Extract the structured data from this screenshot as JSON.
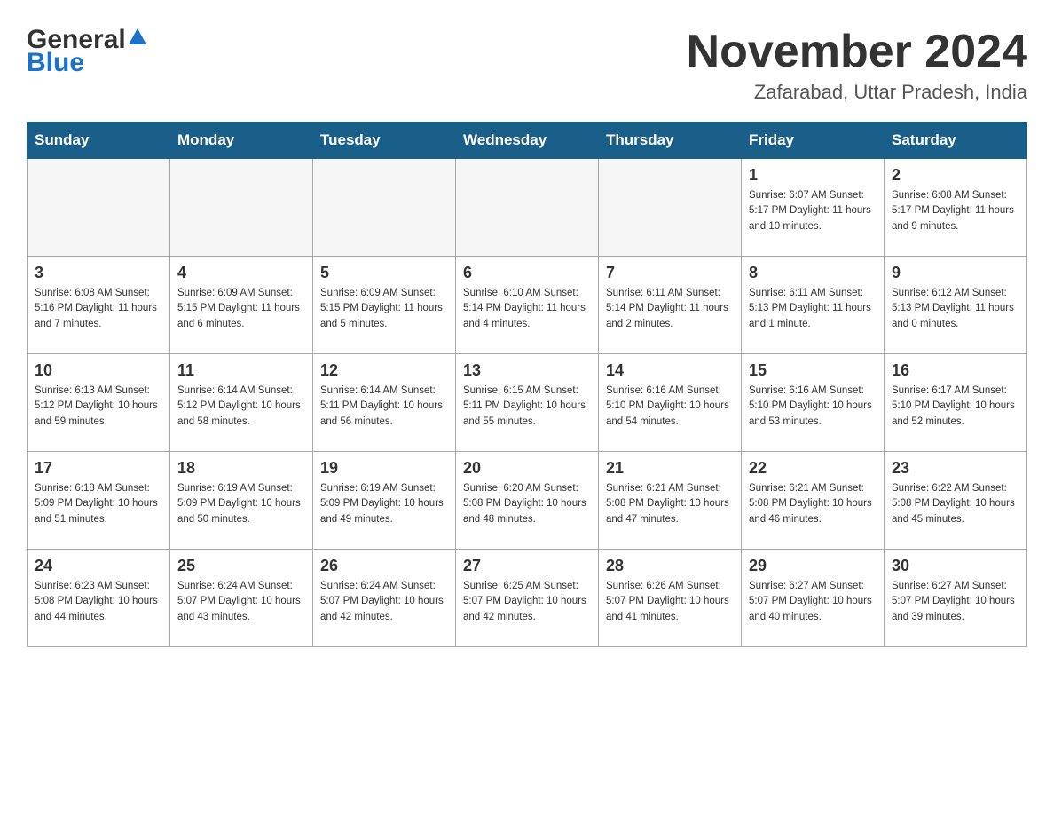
{
  "logo": {
    "line1": "General",
    "line2": "Blue"
  },
  "header": {
    "title": "November 2024",
    "subtitle": "Zafarabad, Uttar Pradesh, India"
  },
  "weekdays": [
    "Sunday",
    "Monday",
    "Tuesday",
    "Wednesday",
    "Thursday",
    "Friday",
    "Saturday"
  ],
  "weeks": [
    [
      {
        "day": "",
        "info": ""
      },
      {
        "day": "",
        "info": ""
      },
      {
        "day": "",
        "info": ""
      },
      {
        "day": "",
        "info": ""
      },
      {
        "day": "",
        "info": ""
      },
      {
        "day": "1",
        "info": "Sunrise: 6:07 AM\nSunset: 5:17 PM\nDaylight: 11 hours\nand 10 minutes."
      },
      {
        "day": "2",
        "info": "Sunrise: 6:08 AM\nSunset: 5:17 PM\nDaylight: 11 hours\nand 9 minutes."
      }
    ],
    [
      {
        "day": "3",
        "info": "Sunrise: 6:08 AM\nSunset: 5:16 PM\nDaylight: 11 hours\nand 7 minutes."
      },
      {
        "day": "4",
        "info": "Sunrise: 6:09 AM\nSunset: 5:15 PM\nDaylight: 11 hours\nand 6 minutes."
      },
      {
        "day": "5",
        "info": "Sunrise: 6:09 AM\nSunset: 5:15 PM\nDaylight: 11 hours\nand 5 minutes."
      },
      {
        "day": "6",
        "info": "Sunrise: 6:10 AM\nSunset: 5:14 PM\nDaylight: 11 hours\nand 4 minutes."
      },
      {
        "day": "7",
        "info": "Sunrise: 6:11 AM\nSunset: 5:14 PM\nDaylight: 11 hours\nand 2 minutes."
      },
      {
        "day": "8",
        "info": "Sunrise: 6:11 AM\nSunset: 5:13 PM\nDaylight: 11 hours\nand 1 minute."
      },
      {
        "day": "9",
        "info": "Sunrise: 6:12 AM\nSunset: 5:13 PM\nDaylight: 11 hours\nand 0 minutes."
      }
    ],
    [
      {
        "day": "10",
        "info": "Sunrise: 6:13 AM\nSunset: 5:12 PM\nDaylight: 10 hours\nand 59 minutes."
      },
      {
        "day": "11",
        "info": "Sunrise: 6:14 AM\nSunset: 5:12 PM\nDaylight: 10 hours\nand 58 minutes."
      },
      {
        "day": "12",
        "info": "Sunrise: 6:14 AM\nSunset: 5:11 PM\nDaylight: 10 hours\nand 56 minutes."
      },
      {
        "day": "13",
        "info": "Sunrise: 6:15 AM\nSunset: 5:11 PM\nDaylight: 10 hours\nand 55 minutes."
      },
      {
        "day": "14",
        "info": "Sunrise: 6:16 AM\nSunset: 5:10 PM\nDaylight: 10 hours\nand 54 minutes."
      },
      {
        "day": "15",
        "info": "Sunrise: 6:16 AM\nSunset: 5:10 PM\nDaylight: 10 hours\nand 53 minutes."
      },
      {
        "day": "16",
        "info": "Sunrise: 6:17 AM\nSunset: 5:10 PM\nDaylight: 10 hours\nand 52 minutes."
      }
    ],
    [
      {
        "day": "17",
        "info": "Sunrise: 6:18 AM\nSunset: 5:09 PM\nDaylight: 10 hours\nand 51 minutes."
      },
      {
        "day": "18",
        "info": "Sunrise: 6:19 AM\nSunset: 5:09 PM\nDaylight: 10 hours\nand 50 minutes."
      },
      {
        "day": "19",
        "info": "Sunrise: 6:19 AM\nSunset: 5:09 PM\nDaylight: 10 hours\nand 49 minutes."
      },
      {
        "day": "20",
        "info": "Sunrise: 6:20 AM\nSunset: 5:08 PM\nDaylight: 10 hours\nand 48 minutes."
      },
      {
        "day": "21",
        "info": "Sunrise: 6:21 AM\nSunset: 5:08 PM\nDaylight: 10 hours\nand 47 minutes."
      },
      {
        "day": "22",
        "info": "Sunrise: 6:21 AM\nSunset: 5:08 PM\nDaylight: 10 hours\nand 46 minutes."
      },
      {
        "day": "23",
        "info": "Sunrise: 6:22 AM\nSunset: 5:08 PM\nDaylight: 10 hours\nand 45 minutes."
      }
    ],
    [
      {
        "day": "24",
        "info": "Sunrise: 6:23 AM\nSunset: 5:08 PM\nDaylight: 10 hours\nand 44 minutes."
      },
      {
        "day": "25",
        "info": "Sunrise: 6:24 AM\nSunset: 5:07 PM\nDaylight: 10 hours\nand 43 minutes."
      },
      {
        "day": "26",
        "info": "Sunrise: 6:24 AM\nSunset: 5:07 PM\nDaylight: 10 hours\nand 42 minutes."
      },
      {
        "day": "27",
        "info": "Sunrise: 6:25 AM\nSunset: 5:07 PM\nDaylight: 10 hours\nand 42 minutes."
      },
      {
        "day": "28",
        "info": "Sunrise: 6:26 AM\nSunset: 5:07 PM\nDaylight: 10 hours\nand 41 minutes."
      },
      {
        "day": "29",
        "info": "Sunrise: 6:27 AM\nSunset: 5:07 PM\nDaylight: 10 hours\nand 40 minutes."
      },
      {
        "day": "30",
        "info": "Sunrise: 6:27 AM\nSunset: 5:07 PM\nDaylight: 10 hours\nand 39 minutes."
      }
    ]
  ]
}
